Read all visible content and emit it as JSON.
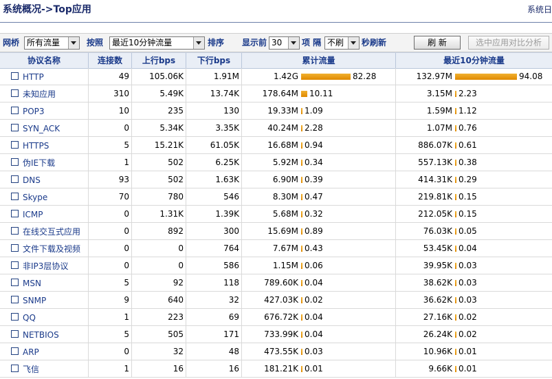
{
  "header": {
    "title": "系统概况->Top应用",
    "right_link": "系统日"
  },
  "toolbar": {
    "bridge_label": "网桥",
    "bridge_value": "所有流量",
    "by_label": "按照",
    "by_value": "最近10分钟流量",
    "sort_label": "排序",
    "show_label": "显示前",
    "show_value": "30",
    "items_label": "项 隔",
    "refresh_value": "不刷",
    "refresh_unit_label": "秒刷新",
    "refresh_button": "刷 新",
    "compare_button": "选中应用对比分析"
  },
  "columns": [
    "协议名称",
    "连接数",
    "上行bps",
    "下行bps",
    "累计流量",
    "最近10分钟流量"
  ],
  "rows": [
    {
      "name": "HTTP",
      "conn": "49",
      "up": "105.06K",
      "down": "1.91M",
      "total": "1.42G",
      "total_pct": 82.28,
      "total_pct_label": "82.28",
      "recent": "132.97M",
      "recent_pct": 94.08,
      "recent_pct_label": "94.08"
    },
    {
      "name": "未知应用",
      "conn": "310",
      "up": "5.49K",
      "down": "13.74K",
      "total": "178.64M",
      "total_pct": 10.11,
      "total_pct_label": "10.11",
      "recent": "3.15M",
      "recent_pct": 2.23,
      "recent_pct_label": "2.23"
    },
    {
      "name": "POP3",
      "conn": "10",
      "up": "235",
      "down": "130",
      "total": "19.33M",
      "total_pct": 1.09,
      "total_pct_label": "1.09",
      "recent": "1.59M",
      "recent_pct": 1.12,
      "recent_pct_label": "1.12"
    },
    {
      "name": "SYN_ACK",
      "conn": "0",
      "up": "5.34K",
      "down": "3.35K",
      "total": "40.24M",
      "total_pct": 2.28,
      "total_pct_label": "2.28",
      "recent": "1.07M",
      "recent_pct": 0.76,
      "recent_pct_label": "0.76"
    },
    {
      "name": "HTTPS",
      "conn": "5",
      "up": "15.21K",
      "down": "61.05K",
      "total": "16.68M",
      "total_pct": 0.94,
      "total_pct_label": "0.94",
      "recent": "886.07K",
      "recent_pct": 0.61,
      "recent_pct_label": "0.61"
    },
    {
      "name": "伪IE下载",
      "conn": "1",
      "up": "502",
      "down": "6.25K",
      "total": "5.92M",
      "total_pct": 0.34,
      "total_pct_label": "0.34",
      "recent": "557.13K",
      "recent_pct": 0.38,
      "recent_pct_label": "0.38"
    },
    {
      "name": "DNS",
      "conn": "93",
      "up": "502",
      "down": "1.63K",
      "total": "6.90M",
      "total_pct": 0.39,
      "total_pct_label": "0.39",
      "recent": "414.31K",
      "recent_pct": 0.29,
      "recent_pct_label": "0.29"
    },
    {
      "name": "Skype",
      "conn": "70",
      "up": "780",
      "down": "546",
      "total": "8.30M",
      "total_pct": 0.47,
      "total_pct_label": "0.47",
      "recent": "219.81K",
      "recent_pct": 0.15,
      "recent_pct_label": "0.15"
    },
    {
      "name": "ICMP",
      "conn": "0",
      "up": "1.31K",
      "down": "1.39K",
      "total": "5.68M",
      "total_pct": 0.32,
      "total_pct_label": "0.32",
      "recent": "212.05K",
      "recent_pct": 0.15,
      "recent_pct_label": "0.15"
    },
    {
      "name": "在线交互式应用",
      "conn": "0",
      "up": "892",
      "down": "300",
      "total": "15.69M",
      "total_pct": 0.89,
      "total_pct_label": "0.89",
      "recent": "76.03K",
      "recent_pct": 0.05,
      "recent_pct_label": "0.05"
    },
    {
      "name": "文件下载及视频",
      "conn": "0",
      "up": "0",
      "down": "764",
      "total": "7.67M",
      "total_pct": 0.43,
      "total_pct_label": "0.43",
      "recent": "53.45K",
      "recent_pct": 0.04,
      "recent_pct_label": "0.04"
    },
    {
      "name": "非IP3层协议",
      "conn": "0",
      "up": "0",
      "down": "586",
      "total": "1.15M",
      "total_pct": 0.06,
      "total_pct_label": "0.06",
      "recent": "39.95K",
      "recent_pct": 0.03,
      "recent_pct_label": "0.03"
    },
    {
      "name": "MSN",
      "conn": "5",
      "up": "92",
      "down": "118",
      "total": "789.60K",
      "total_pct": 0.04,
      "total_pct_label": "0.04",
      "recent": "38.62K",
      "recent_pct": 0.03,
      "recent_pct_label": "0.03"
    },
    {
      "name": "SNMP",
      "conn": "9",
      "up": "640",
      "down": "32",
      "total": "427.03K",
      "total_pct": 0.02,
      "total_pct_label": "0.02",
      "recent": "36.62K",
      "recent_pct": 0.03,
      "recent_pct_label": "0.03"
    },
    {
      "name": "QQ",
      "conn": "1",
      "up": "223",
      "down": "69",
      "total": "676.72K",
      "total_pct": 0.04,
      "total_pct_label": "0.04",
      "recent": "27.16K",
      "recent_pct": 0.02,
      "recent_pct_label": "0.02"
    },
    {
      "name": "NETBIOS",
      "conn": "5",
      "up": "505",
      "down": "171",
      "total": "733.99K",
      "total_pct": 0.04,
      "total_pct_label": "0.04",
      "recent": "26.24K",
      "recent_pct": 0.02,
      "recent_pct_label": "0.02"
    },
    {
      "name": "ARP",
      "conn": "0",
      "up": "32",
      "down": "48",
      "total": "473.55K",
      "total_pct": 0.03,
      "total_pct_label": "0.03",
      "recent": "10.96K",
      "recent_pct": 0.01,
      "recent_pct_label": "0.01"
    },
    {
      "name": "飞信",
      "conn": "1",
      "up": "16",
      "down": "16",
      "total": "181.21K",
      "total_pct": 0.01,
      "total_pct_label": "0.01",
      "recent": "9.66K",
      "recent_pct": 0.01,
      "recent_pct_label": "0.01"
    }
  ],
  "colors": {
    "accent_text": "#1a3a8a",
    "bar": "#e8980a",
    "header_bg": "#e9eef6"
  }
}
